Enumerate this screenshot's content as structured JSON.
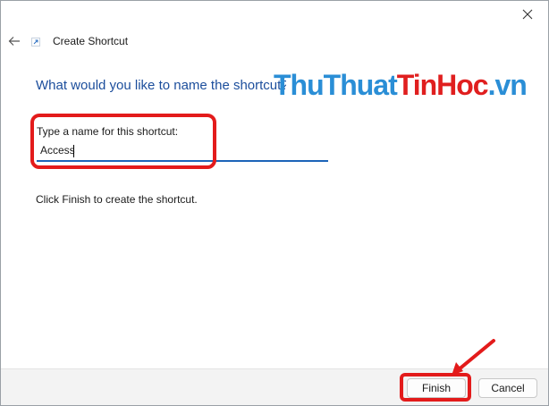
{
  "window": {
    "title": "Create Shortcut",
    "close_icon": "close-icon",
    "back_icon": "back-arrow-icon",
    "app_icon": "shortcut-icon"
  },
  "main": {
    "heading": "What would you like to name the shortcut?",
    "field_label": "Type a name for this shortcut:",
    "name_value": "Access",
    "info_text": "Click Finish to create the shortcut."
  },
  "watermark": {
    "part1": "ThuThuat",
    "part2": "TinHoc",
    "part3": ".vn"
  },
  "footer": {
    "finish_label": "Finish",
    "cancel_label": "Cancel"
  },
  "colors": {
    "heading": "#1c4e9c",
    "highlight": "#e31b1b",
    "input_underline": "#1c64b8"
  }
}
